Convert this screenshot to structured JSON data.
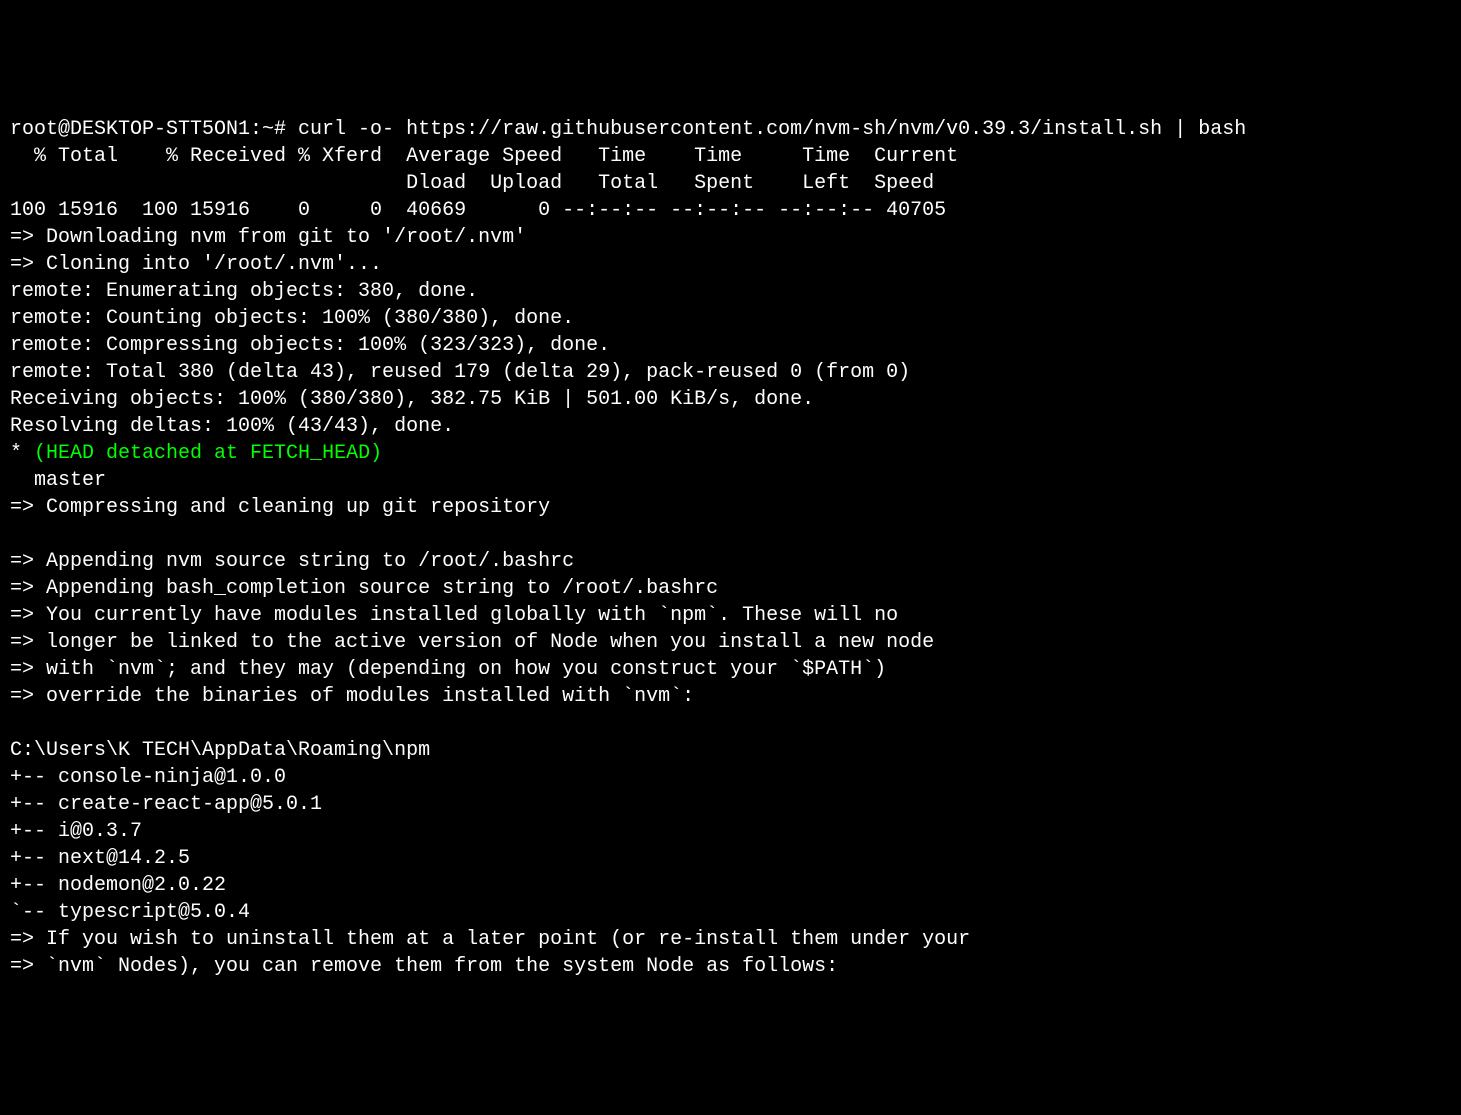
{
  "terminal": {
    "prompt": "root@DESKTOP-STT5ON1:~# ",
    "command": "curl -o- https://raw.githubusercontent.com/nvm-sh/nvm/v0.39.3/install.sh | bash",
    "curl_header1": "  % Total    % Received % Xferd  Average Speed   Time    Time     Time  Current",
    "curl_header2": "                                 Dload  Upload   Total   Spent    Left  Speed",
    "curl_progress": "100 15916  100 15916    0     0  40669      0 --:--:-- --:--:-- --:--:-- 40705",
    "line_download": "=> Downloading nvm from git to '/root/.nvm'",
    "line_cloning": "=> Cloning into '/root/.nvm'...",
    "line_enum": "remote: Enumerating objects: 380, done.",
    "line_count": "remote: Counting objects: 100% (380/380), done.",
    "line_compress": "remote: Compressing objects: 100% (323/323), done.",
    "line_total": "remote: Total 380 (delta 43), reused 179 (delta 29), pack-reused 0 (from 0)",
    "line_receiving": "Receiving objects: 100% (380/380), 382.75 KiB | 501.00 KiB/s, done.",
    "line_resolving": "Resolving deltas: 100% (43/43), done.",
    "branch_star": "* ",
    "branch_head": "(HEAD detached at FETCH_HEAD)",
    "branch_master": "  master",
    "line_compressing": "=> Compressing and cleaning up git repository",
    "blank": "",
    "line_append1": "=> Appending nvm source string to /root/.bashrc",
    "line_append2": "=> Appending bash_completion source string to /root/.bashrc",
    "line_modules1": "=> You currently have modules installed globally with `npm`. These will no",
    "line_modules2": "=> longer be linked to the active version of Node when you install a new node",
    "line_modules3": "=> with `nvm`; and they may (depending on how you construct your `$PATH`)",
    "line_modules4": "=> override the binaries of modules installed with `nvm`:",
    "npm_path": "C:\\Users\\K TECH\\AppData\\Roaming\\npm",
    "pkg1": "+-- console-ninja@1.0.0",
    "pkg2": "+-- create-react-app@5.0.1",
    "pkg3": "+-- i@0.3.7",
    "pkg4": "+-- next@14.2.5",
    "pkg5": "+-- nodemon@2.0.22",
    "pkg6": "`-- typescript@5.0.4",
    "line_uninstall1": "=> If you wish to uninstall them at a later point (or re-install them under your",
    "line_uninstall2": "=> `nvm` Nodes), you can remove them from the system Node as follows:"
  }
}
